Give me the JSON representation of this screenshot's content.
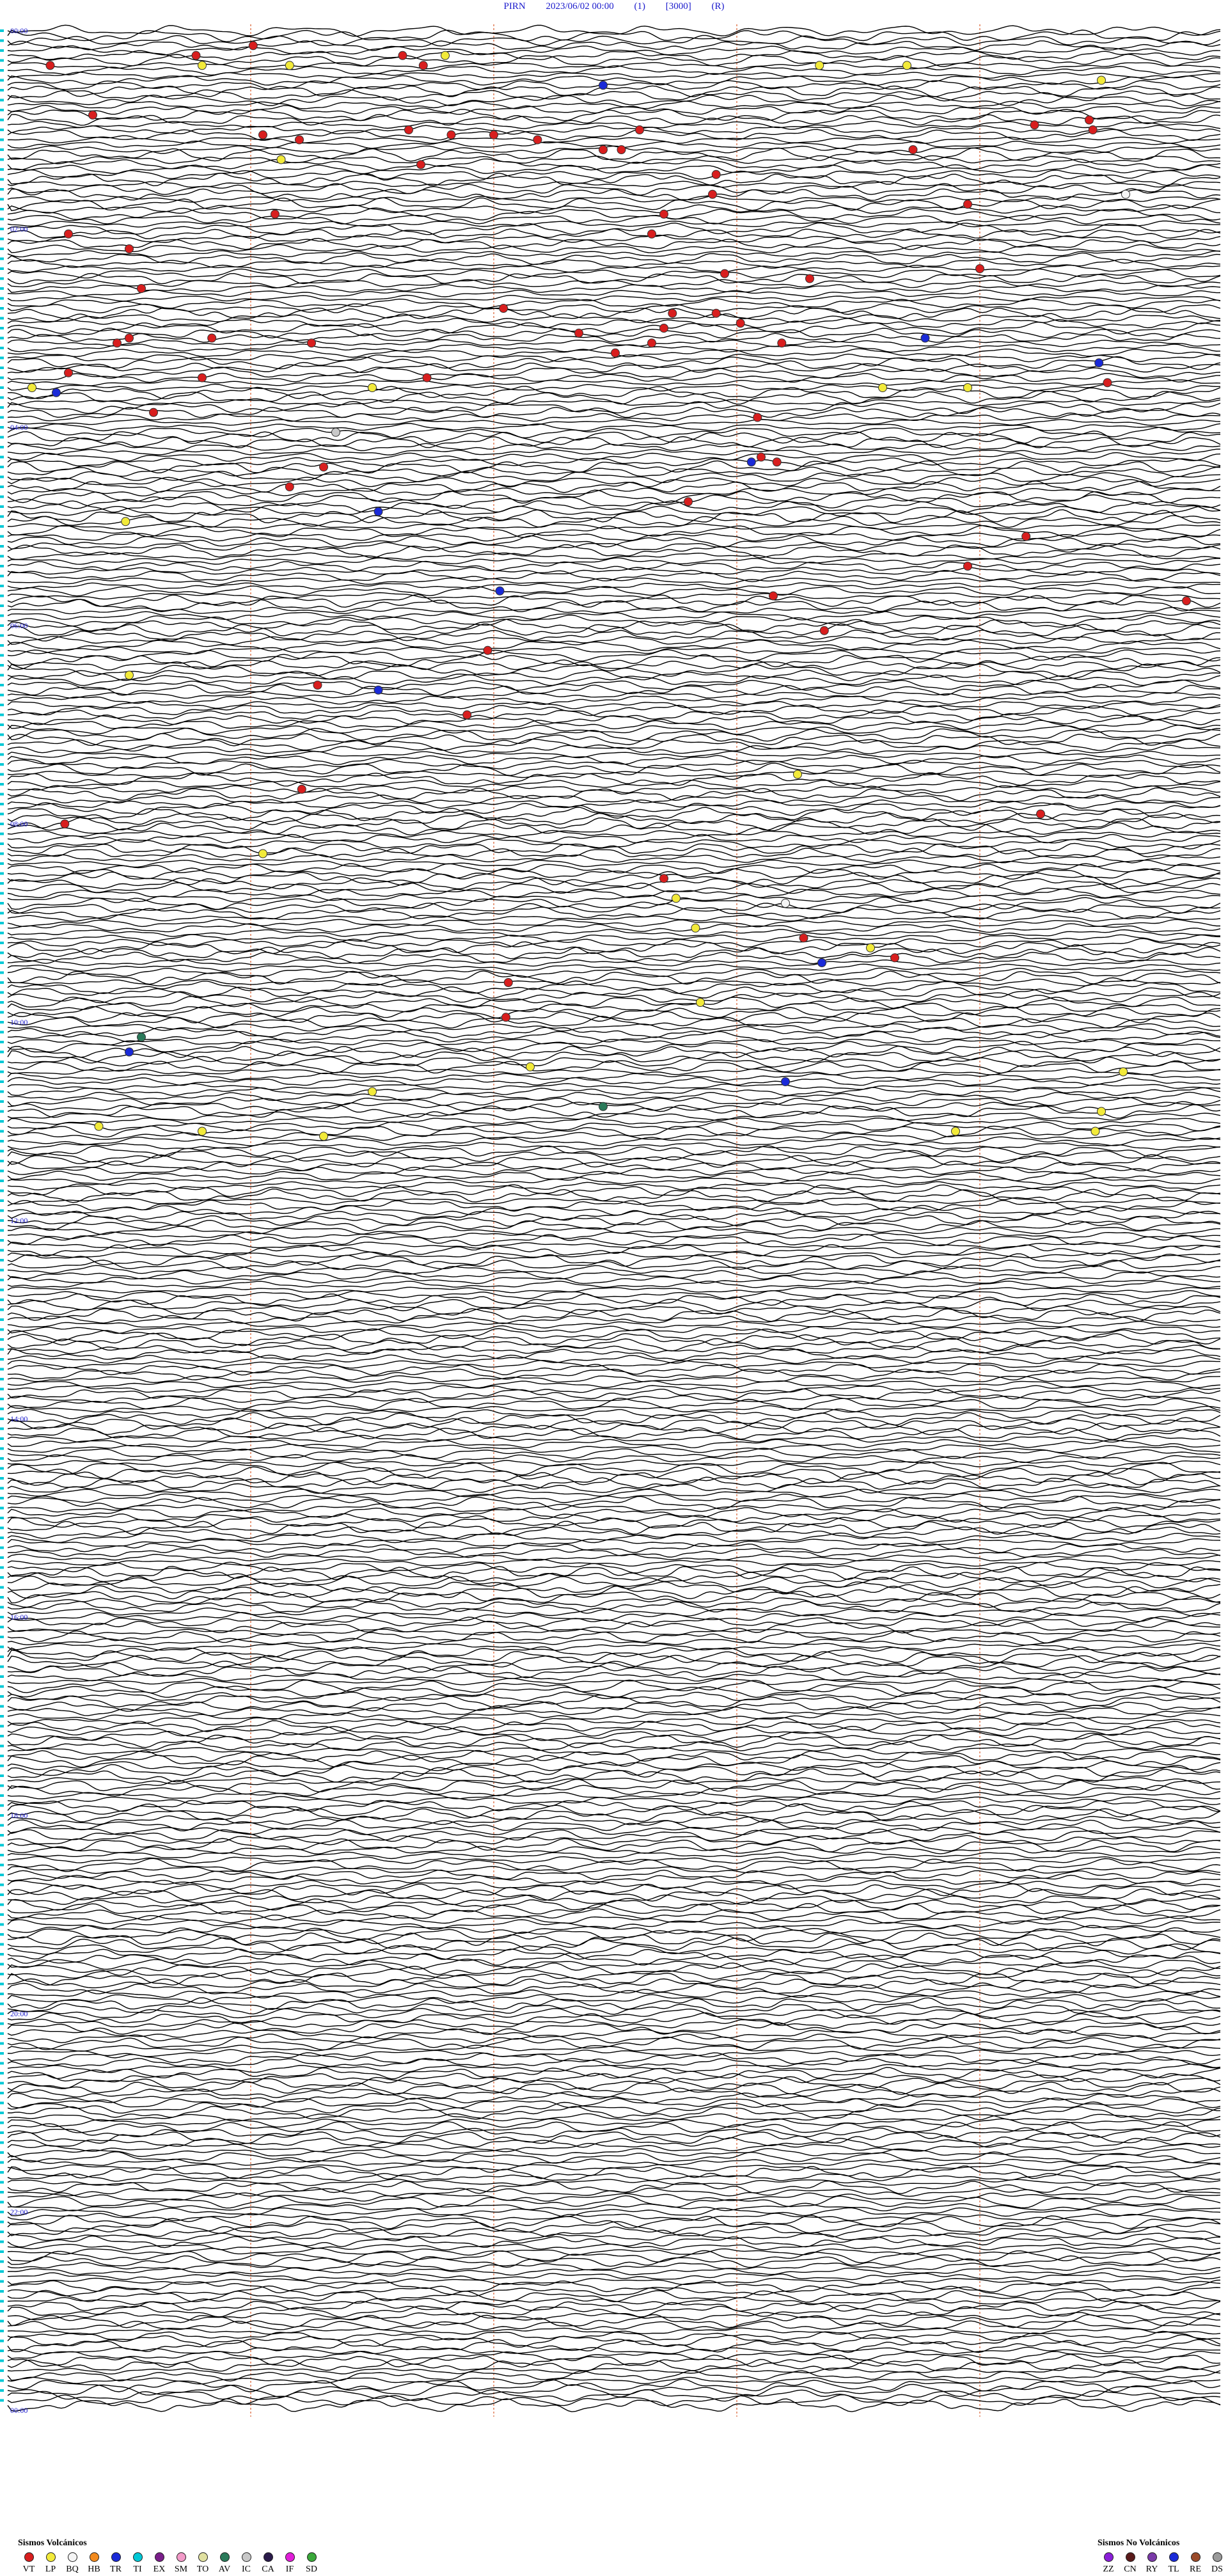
{
  "header": {
    "station": "PIRN",
    "datetime": "2023/06/02 00:00",
    "channel": "(1)",
    "scale": "[3000]",
    "mode": "(R)"
  },
  "colors": {
    "trace": "#000000",
    "grid": "#d85a2a",
    "header": "#1a1acc",
    "hour_label": "#1a1acc",
    "side_marker": "#00c8d6"
  },
  "chart_data": {
    "type": "helicorder",
    "lines_per_hour": 20,
    "hours": 24,
    "hour_labels": [
      "00:00",
      "02:00",
      "04:00",
      "06:00",
      "08:00",
      "10:00",
      "12:00",
      "14:00",
      "16:00",
      "18:00",
      "20:00",
      "22:00",
      "00:00"
    ],
    "vertical_guides_fraction": [
      0.2,
      0.4,
      0.6,
      0.8
    ],
    "events": [
      {
        "line": 3,
        "x": 0.202,
        "type": "VT"
      },
      {
        "line": 5,
        "x": 0.155,
        "type": "VT"
      },
      {
        "line": 5,
        "x": 0.325,
        "type": "VT"
      },
      {
        "line": 5,
        "x": 0.36,
        "type": "LP"
      },
      {
        "line": 7,
        "x": 0.035,
        "type": "VT"
      },
      {
        "line": 7,
        "x": 0.16,
        "type": "LP"
      },
      {
        "line": 7,
        "x": 0.232,
        "type": "LP"
      },
      {
        "line": 7,
        "x": 0.342,
        "type": "VT"
      },
      {
        "line": 7,
        "x": 0.668,
        "type": "LP"
      },
      {
        "line": 7,
        "x": 0.74,
        "type": "LP"
      },
      {
        "line": 11,
        "x": 0.49,
        "type": "TR"
      },
      {
        "line": 10,
        "x": 0.9,
        "type": "LP"
      },
      {
        "line": 17,
        "x": 0.07,
        "type": "VT"
      },
      {
        "line": 18,
        "x": 0.89,
        "type": "VT"
      },
      {
        "line": 19,
        "x": 0.845,
        "type": "VT"
      },
      {
        "line": 20,
        "x": 0.33,
        "type": "VT"
      },
      {
        "line": 21,
        "x": 0.21,
        "type": "VT"
      },
      {
        "line": 21,
        "x": 0.365,
        "type": "VT"
      },
      {
        "line": 21,
        "x": 0.4,
        "type": "VT"
      },
      {
        "line": 20,
        "x": 0.52,
        "type": "VT"
      },
      {
        "line": 20,
        "x": 0.893,
        "type": "VT"
      },
      {
        "line": 22,
        "x": 0.436,
        "type": "VT"
      },
      {
        "line": 22,
        "x": 0.24,
        "type": "VT"
      },
      {
        "line": 24,
        "x": 0.49,
        "type": "VT"
      },
      {
        "line": 24,
        "x": 0.505,
        "type": "VT"
      },
      {
        "line": 24,
        "x": 0.745,
        "type": "VT"
      },
      {
        "line": 26,
        "x": 0.225,
        "type": "LP"
      },
      {
        "line": 27,
        "x": 0.34,
        "type": "VT"
      },
      {
        "line": 29,
        "x": 0.583,
        "type": "VT"
      },
      {
        "line": 33,
        "x": 0.92,
        "type": "BQ"
      },
      {
        "line": 33,
        "x": 0.58,
        "type": "VT"
      },
      {
        "line": 35,
        "x": 0.79,
        "type": "VT"
      },
      {
        "line": 37,
        "x": 0.22,
        "type": "VT"
      },
      {
        "line": 41,
        "x": 0.53,
        "type": "VT"
      },
      {
        "line": 37,
        "x": 0.54,
        "type": "VT"
      },
      {
        "line": 41,
        "x": 0.05,
        "type": "VT"
      },
      {
        "line": 44,
        "x": 0.1,
        "type": "VT"
      },
      {
        "line": 48,
        "x": 0.8,
        "type": "VT"
      },
      {
        "line": 49,
        "x": 0.59,
        "type": "VT"
      },
      {
        "line": 50,
        "x": 0.66,
        "type": "VT"
      },
      {
        "line": 52,
        "x": 0.11,
        "type": "VT"
      },
      {
        "line": 56,
        "x": 0.408,
        "type": "VT"
      },
      {
        "line": 57,
        "x": 0.547,
        "type": "VT"
      },
      {
        "line": 57,
        "x": 0.583,
        "type": "VT"
      },
      {
        "line": 59,
        "x": 0.603,
        "type": "VT"
      },
      {
        "line": 60,
        "x": 0.54,
        "type": "VT"
      },
      {
        "line": 61,
        "x": 0.47,
        "type": "VT"
      },
      {
        "line": 62,
        "x": 0.1,
        "type": "VT"
      },
      {
        "line": 62,
        "x": 0.168,
        "type": "VT"
      },
      {
        "line": 63,
        "x": 0.637,
        "type": "VT"
      },
      {
        "line": 62,
        "x": 0.755,
        "type": "TR"
      },
      {
        "line": 63,
        "x": 0.09,
        "type": "VT"
      },
      {
        "line": 63,
        "x": 0.25,
        "type": "VT"
      },
      {
        "line": 63,
        "x": 0.53,
        "type": "VT"
      },
      {
        "line": 65,
        "x": 0.5,
        "type": "VT"
      },
      {
        "line": 67,
        "x": 0.898,
        "type": "TR"
      },
      {
        "line": 69,
        "x": 0.05,
        "type": "VT"
      },
      {
        "line": 70,
        "x": 0.16,
        "type": "VT"
      },
      {
        "line": 70,
        "x": 0.345,
        "type": "VT"
      },
      {
        "line": 71,
        "x": 0.905,
        "type": "VT"
      },
      {
        "line": 72,
        "x": 0.02,
        "type": "LP"
      },
      {
        "line": 72,
        "x": 0.3,
        "type": "LP"
      },
      {
        "line": 72,
        "x": 0.72,
        "type": "LP"
      },
      {
        "line": 72,
        "x": 0.79,
        "type": "LP"
      },
      {
        "line": 73,
        "x": 0.04,
        "type": "TR"
      },
      {
        "line": 77,
        "x": 0.12,
        "type": "VT"
      },
      {
        "line": 78,
        "x": 0.617,
        "type": "VT"
      },
      {
        "line": 81,
        "x": 0.27,
        "type": "IC"
      },
      {
        "line": 86,
        "x": 0.62,
        "type": "VT"
      },
      {
        "line": 87,
        "x": 0.612,
        "type": "TR"
      },
      {
        "line": 87,
        "x": 0.633,
        "type": "VT"
      },
      {
        "line": 88,
        "x": 0.26,
        "type": "VT"
      },
      {
        "line": 92,
        "x": 0.232,
        "type": "VT"
      },
      {
        "line": 95,
        "x": 0.56,
        "type": "VT"
      },
      {
        "line": 97,
        "x": 0.305,
        "type": "TR"
      },
      {
        "line": 99,
        "x": 0.097,
        "type": "LP"
      },
      {
        "line": 102,
        "x": 0.838,
        "type": "VT"
      },
      {
        "line": 108,
        "x": 0.79,
        "type": "VT"
      },
      {
        "line": 113,
        "x": 0.405,
        "type": "TR"
      },
      {
        "line": 114,
        "x": 0.63,
        "type": "VT"
      },
      {
        "line": 115,
        "x": 0.97,
        "type": "VT"
      },
      {
        "line": 121,
        "x": 0.672,
        "type": "VT"
      },
      {
        "line": 125,
        "x": 0.395,
        "type": "VT"
      },
      {
        "line": 130,
        "x": 0.1,
        "type": "LP"
      },
      {
        "line": 132,
        "x": 0.255,
        "type": "VT"
      },
      {
        "line": 133,
        "x": 0.305,
        "type": "TR"
      },
      {
        "line": 138,
        "x": 0.378,
        "type": "VT"
      },
      {
        "line": 150,
        "x": 0.65,
        "type": "LP"
      },
      {
        "line": 153,
        "x": 0.242,
        "type": "VT"
      },
      {
        "line": 158,
        "x": 0.85,
        "type": "VT"
      },
      {
        "line": 160,
        "x": 0.047,
        "type": "VT"
      },
      {
        "line": 166,
        "x": 0.21,
        "type": "LP"
      },
      {
        "line": 171,
        "x": 0.54,
        "type": "VT"
      },
      {
        "line": 176,
        "x": 0.64,
        "type": "BQ"
      },
      {
        "line": 181,
        "x": 0.566,
        "type": "LP"
      },
      {
        "line": 183,
        "x": 0.655,
        "type": "VT"
      },
      {
        "line": 185,
        "x": 0.71,
        "type": "LP"
      },
      {
        "line": 187,
        "x": 0.73,
        "type": "VT"
      },
      {
        "line": 188,
        "x": 0.67,
        "type": "TR"
      },
      {
        "line": 192,
        "x": 0.412,
        "type": "VT"
      },
      {
        "line": 196,
        "x": 0.57,
        "type": "LP"
      },
      {
        "line": 199,
        "x": 0.41,
        "type": "VT"
      },
      {
        "line": 203,
        "x": 0.11,
        "type": "AV"
      },
      {
        "line": 206,
        "x": 0.1,
        "type": "TR"
      },
      {
        "line": 209,
        "x": 0.43,
        "type": "LP"
      },
      {
        "line": 210,
        "x": 0.918,
        "type": "LP"
      },
      {
        "line": 212,
        "x": 0.64,
        "type": "TR"
      },
      {
        "line": 214,
        "x": 0.3,
        "type": "LP"
      },
      {
        "line": 217,
        "x": 0.49,
        "type": "AV"
      },
      {
        "line": 218,
        "x": 0.9,
        "type": "LP"
      },
      {
        "line": 221,
        "x": 0.075,
        "type": "LP"
      },
      {
        "line": 222,
        "x": 0.16,
        "type": "LP"
      },
      {
        "line": 222,
        "x": 0.78,
        "type": "LP"
      },
      {
        "line": 222,
        "x": 0.895,
        "type": "LP"
      },
      {
        "line": 223,
        "x": 0.26,
        "type": "LP"
      },
      {
        "line": 175,
        "x": 0.55,
        "type": "LP"
      }
    ]
  },
  "legend_volcanic": {
    "title": "Sismos Volcánicos",
    "items": [
      {
        "code": "VT",
        "color": "#d81e1e"
      },
      {
        "code": "LP",
        "color": "#f2ea3a"
      },
      {
        "code": "BQ",
        "color": "#f5f5f5"
      },
      {
        "code": "HB",
        "color": "#f28a1e"
      },
      {
        "code": "TR",
        "color": "#1a2ad8"
      },
      {
        "code": "TI",
        "color": "#00c8d6"
      },
      {
        "code": "EX",
        "color": "#7a1e8a"
      },
      {
        "code": "SM",
        "color": "#f29ac8"
      },
      {
        "code": "TO",
        "color": "#e0e0a0"
      },
      {
        "code": "AV",
        "color": "#2a7a5a"
      },
      {
        "code": "IC",
        "color": "#c8c8c8"
      },
      {
        "code": "CA",
        "color": "#2a1a4a"
      },
      {
        "code": "IF",
        "color": "#e01ed8"
      },
      {
        "code": "SD",
        "color": "#3aa83a"
      }
    ]
  },
  "legend_nonvolcanic": {
    "title": "Sismos No Volcánicos",
    "items": [
      {
        "code": "ZZ",
        "color": "#8a1ed8"
      },
      {
        "code": "CN",
        "color": "#5a1a1a"
      },
      {
        "code": "RY",
        "color": "#7a3aa8"
      },
      {
        "code": "TL",
        "color": "#1a2ad8"
      },
      {
        "code": "RE",
        "color": "#9a4a2a"
      },
      {
        "code": "DS",
        "color": "#9a9a9a"
      }
    ]
  }
}
